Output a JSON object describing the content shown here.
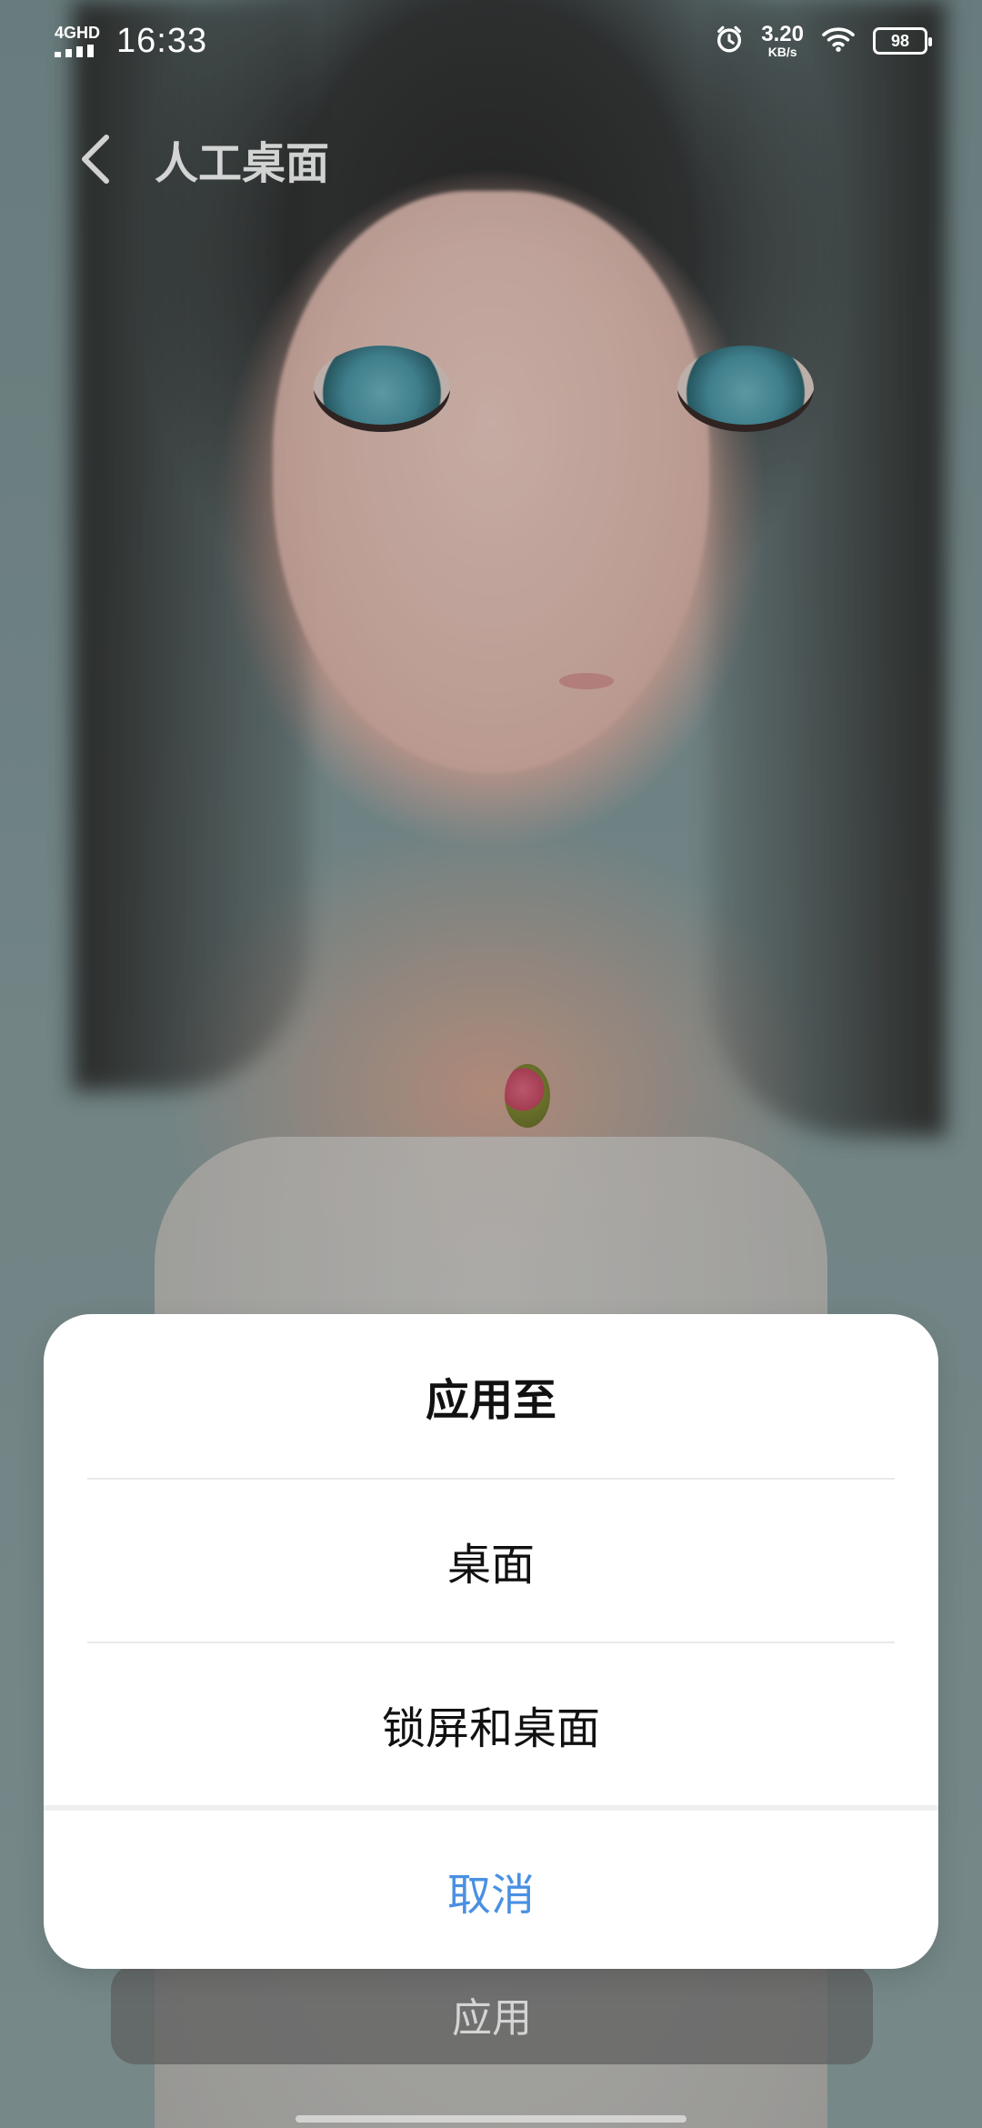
{
  "status_bar": {
    "network": "4GHD",
    "time": "16:33",
    "speed_value": "3.20",
    "speed_unit": "KB/s",
    "battery": "98"
  },
  "header": {
    "title": "人工桌面"
  },
  "bottom_button": {
    "label": "应用"
  },
  "sheet": {
    "title": "应用至",
    "options": [
      {
        "label": "桌面"
      },
      {
        "label": "锁屏和桌面"
      }
    ],
    "cancel_label": "取消"
  },
  "colors": {
    "accent": "#4a90e2",
    "sheet_bg": "#ffffff"
  },
  "icons": {
    "back": "chevron-left-icon",
    "alarm": "alarm-icon",
    "wifi": "wifi-icon",
    "battery": "battery-icon",
    "signal": "signal-icon"
  }
}
